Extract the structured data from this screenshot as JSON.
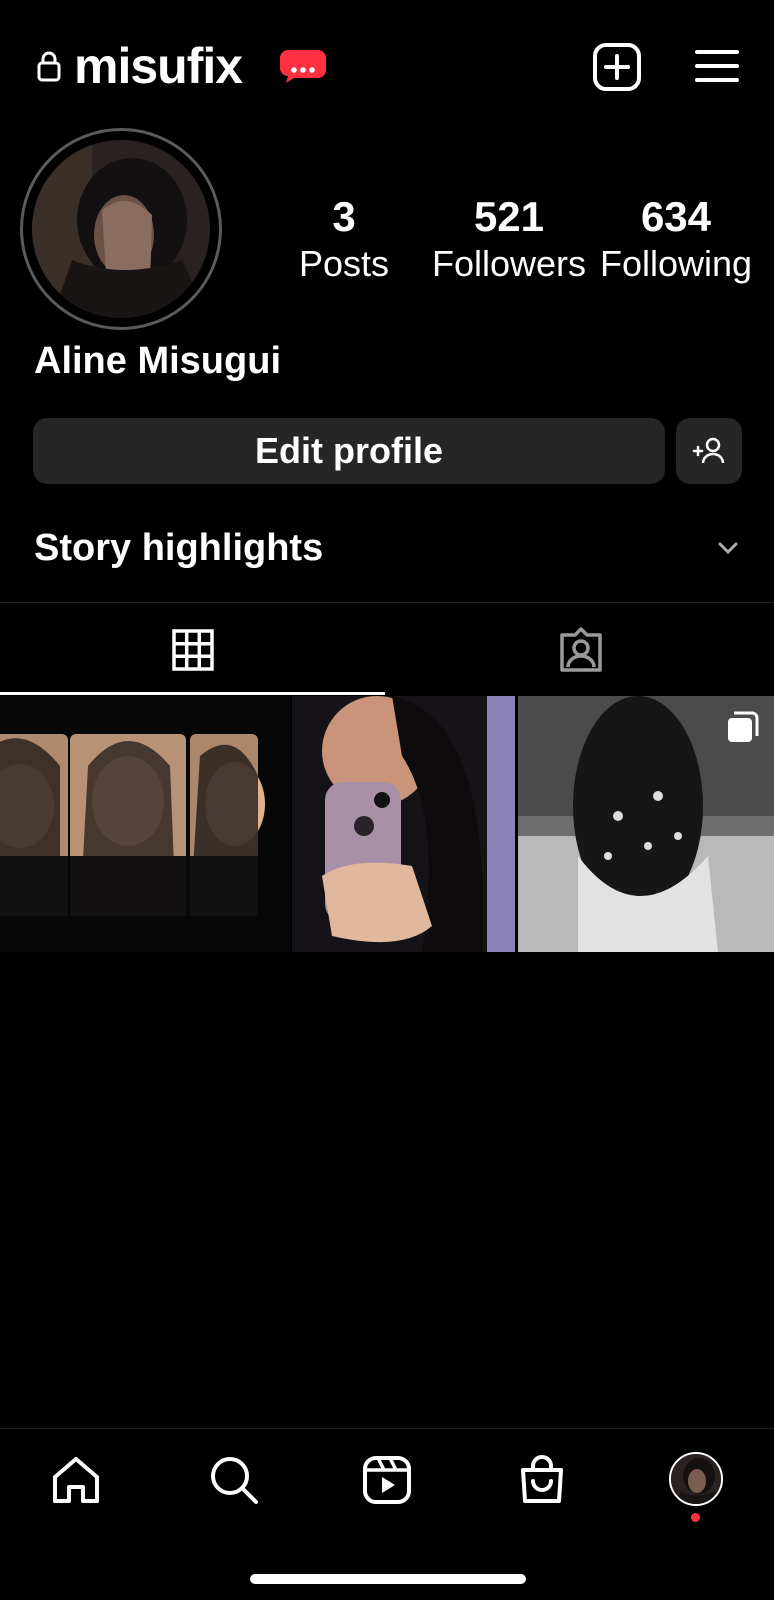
{
  "header": {
    "username": "misufix",
    "lock_icon": "lock-icon",
    "badge_icon": "notification-dots-badge",
    "create_icon": "plus-square-icon",
    "menu_icon": "hamburger-menu-icon"
  },
  "profile": {
    "name": "Aline Misugui",
    "stats": [
      {
        "value": "3",
        "label": "Posts"
      },
      {
        "value": "521",
        "label": "Followers"
      },
      {
        "value": "634",
        "label": "Following"
      }
    ],
    "edit_button": "Edit profile",
    "story_highlights": "Story highlights"
  },
  "tabs": [
    {
      "icon": "grid-icon",
      "selected": true
    },
    {
      "icon": "tagged-person-icon",
      "selected": false
    }
  ],
  "nav": [
    "home-icon",
    "search-icon",
    "reels-icon",
    "shop-icon",
    "profile-avatar"
  ],
  "colors": {
    "background": "#000000",
    "button": "#262626",
    "accent_red": "#ff3040"
  }
}
